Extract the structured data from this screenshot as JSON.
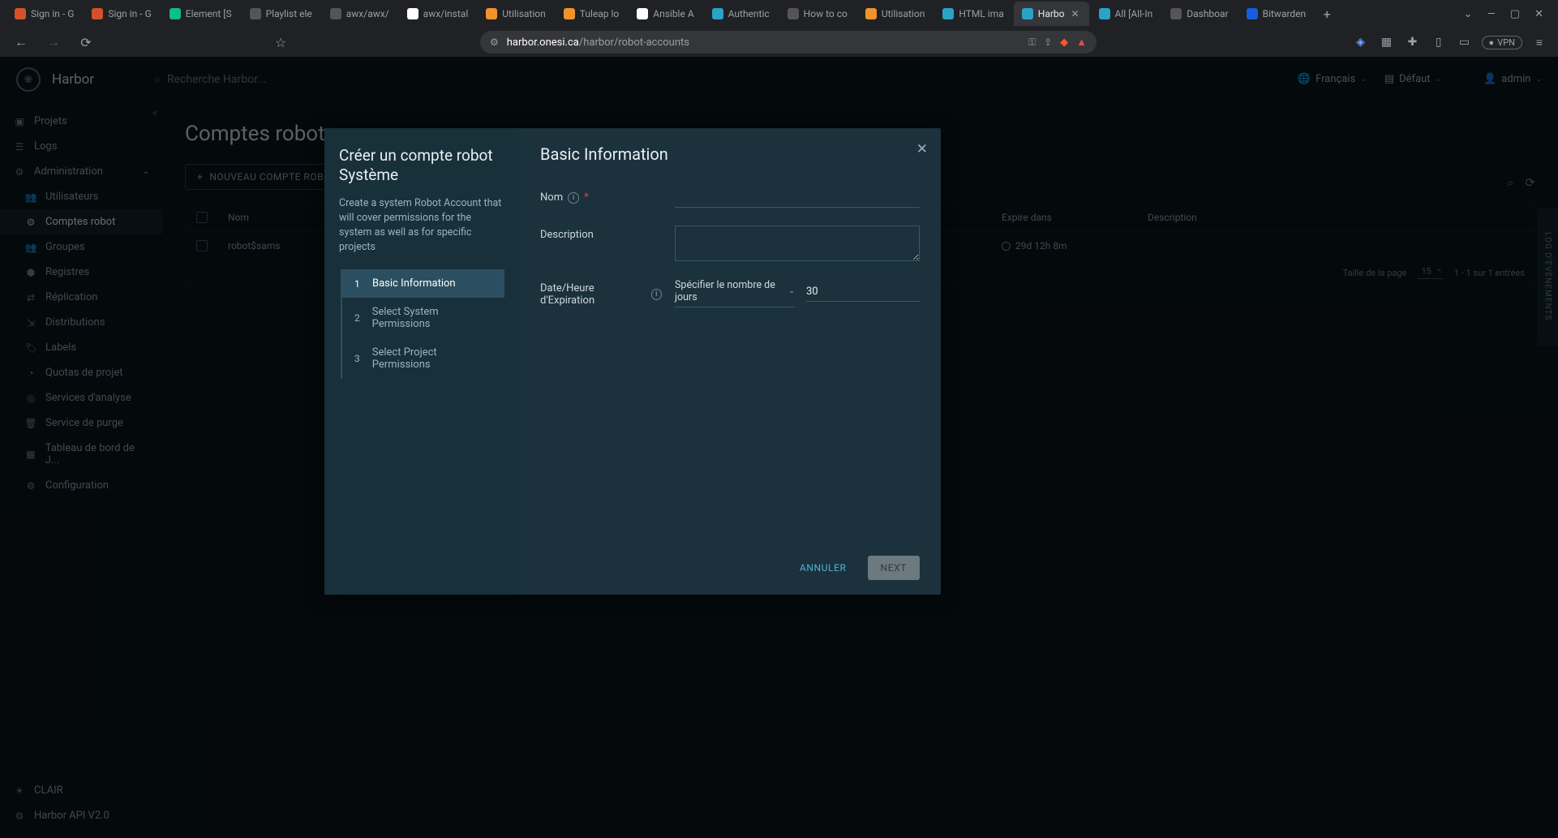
{
  "browser": {
    "tabs": [
      {
        "label": "Sign in - G",
        "fav": "#d4512a"
      },
      {
        "label": "Sign in - G",
        "fav": "#d4512a"
      },
      {
        "label": "Element [S",
        "fav": "#0dbd8b"
      },
      {
        "label": "Playlist ele",
        "fav": "#555"
      },
      {
        "label": "awx/awx/",
        "fav": "#555"
      },
      {
        "label": "awx/instal",
        "fav": "#fff"
      },
      {
        "label": "Utilisation",
        "fav": "#f0932b"
      },
      {
        "label": "Tuleap lo",
        "fav": "#f0932b"
      },
      {
        "label": "Ansible A",
        "fav": "#fff"
      },
      {
        "label": "Authentic",
        "fav": "#2aa3c7"
      },
      {
        "label": "How to co",
        "fav": "#555"
      },
      {
        "label": "Utilisation",
        "fav": "#f0932b"
      },
      {
        "label": "HTML ima",
        "fav": "#2aa3c7"
      },
      {
        "label": "Harbo",
        "fav": "#2aa3c7",
        "active": true
      },
      {
        "label": "All [All-In",
        "fav": "#2aa3c7"
      },
      {
        "label": "Dashboar",
        "fav": "#555"
      },
      {
        "label": "Bitwarden",
        "fav": "#175ddc"
      }
    ],
    "url_host": "harbor.onesi.ca",
    "url_path": "/harbor/robot-accounts",
    "vpn": "VPN"
  },
  "header": {
    "app_name": "Harbor",
    "search_placeholder": "Recherche Harbor...",
    "language": "Français",
    "theme": "Défaut",
    "user": "admin"
  },
  "sidebar": {
    "projects": "Projets",
    "logs": "Logs",
    "admin": "Administration",
    "users": "Utilisateurs",
    "robots": "Comptes robot",
    "groups": "Groupes",
    "registries": "Registres",
    "replication": "Réplication",
    "distributions": "Distributions",
    "labels": "Labels",
    "quotas": "Quotas de projet",
    "scanners": "Services d'analyse",
    "purge": "Service de purge",
    "dashboard": "Tableau de bord de J...",
    "config": "Configuration",
    "theme_toggle": "CLAIR",
    "api": "Harbor API V2.0"
  },
  "page": {
    "title": "Comptes robot",
    "new_button": "NOUVEAU COMPTE ROBOT",
    "col_name": "Nom",
    "col_expires": "Expire dans",
    "col_desc": "Description",
    "row1_name": "robot$sams",
    "row1_exp": "29d 12h 8m",
    "page_size_label": "Taille de la page",
    "page_size": "15",
    "range": "1 - 1 sur 1 entrées"
  },
  "event_tab": "LOG D'ÉVÈNEMENTS",
  "modal": {
    "title": "Créer un compte robot Système",
    "subtitle": "Create a system Robot Account that will cover permissions for the system as well as for specific projects",
    "step1": "Basic Information",
    "step1_num": "1",
    "step2": "Select System Permissions",
    "step2_num": "2",
    "step3": "Select Project Permissions",
    "step3_num": "3",
    "right_title": "Basic Information",
    "label_name": "Nom",
    "label_desc": "Description",
    "label_exp": "Date/Heure d'Expiration",
    "exp_select": "Spécifier le nombre de jours",
    "exp_days": "30",
    "btn_cancel": "ANNULER",
    "btn_next": "NEXT"
  }
}
